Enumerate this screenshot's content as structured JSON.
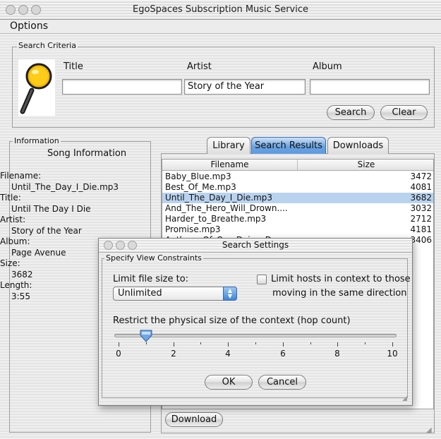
{
  "window": {
    "title": "EgoSpaces Subscription Music Service"
  },
  "menu": {
    "options": "Options"
  },
  "search": {
    "group_label": "Search Criteria",
    "icon": "magnifier-icon",
    "title_label": "Title",
    "artist_label": "Artist",
    "album_label": "Album",
    "title_value": "",
    "artist_value": "Story of the Year",
    "album_value": "",
    "search_button": "Search",
    "clear_button": "Clear"
  },
  "info": {
    "group_label": "Information",
    "heading": "Song Information",
    "filename_label": "Filename:",
    "filename_value": "Until_The_Day_I_Die.mp3",
    "title_label": "Title:",
    "title_value": "Until The Day I Die",
    "artist_label": "Artist:",
    "artist_value": "Story of the Year",
    "album_label": "Album:",
    "album_value": "Page Avenue",
    "size_label": "Size:",
    "size_value": "3682",
    "length_label": "Length:",
    "length_value": "3:55"
  },
  "tabs": [
    {
      "label": "Library",
      "active": false
    },
    {
      "label": "Search Results",
      "active": true
    },
    {
      "label": "Downloads",
      "active": false
    }
  ],
  "results": {
    "headers": [
      "Filename",
      "Size"
    ],
    "rows": [
      {
        "filename": "Baby_Blue.mp3",
        "size": "3472"
      },
      {
        "filename": "Best_Of_Me.mp3",
        "size": "4081"
      },
      {
        "filename": "Until_The_Day_I_Die.mp3",
        "size": "3682",
        "selected": true
      },
      {
        "filename": "And_The_Hero_Will_Drown....",
        "size": "3032"
      },
      {
        "filename": "Harder_to_Breathe.mp3",
        "size": "2712"
      },
      {
        "filename": "Promise.mp3",
        "size": "4181"
      },
      {
        "filename": "Anthem_Of_Our_Dying_Day....",
        "size": "3406"
      }
    ]
  },
  "download_button": "Download",
  "dialog": {
    "title": "Search Settings",
    "group_label": "Specify View Constraints",
    "limit_size_label": "Limit file size to:",
    "limit_size_value": "Unlimited",
    "limit_hosts_line1": "Limit hosts in context to those",
    "limit_hosts_line2": "moving in the same direction",
    "limit_hosts_checked": false,
    "hop_label": "Restrict the physical size of the context (hop count)",
    "slider": {
      "min": 0,
      "max": 10,
      "value": 1,
      "labels": [
        "0",
        "2",
        "4",
        "6",
        "8",
        "10"
      ]
    },
    "ok_button": "OK",
    "cancel_button": "Cancel"
  }
}
